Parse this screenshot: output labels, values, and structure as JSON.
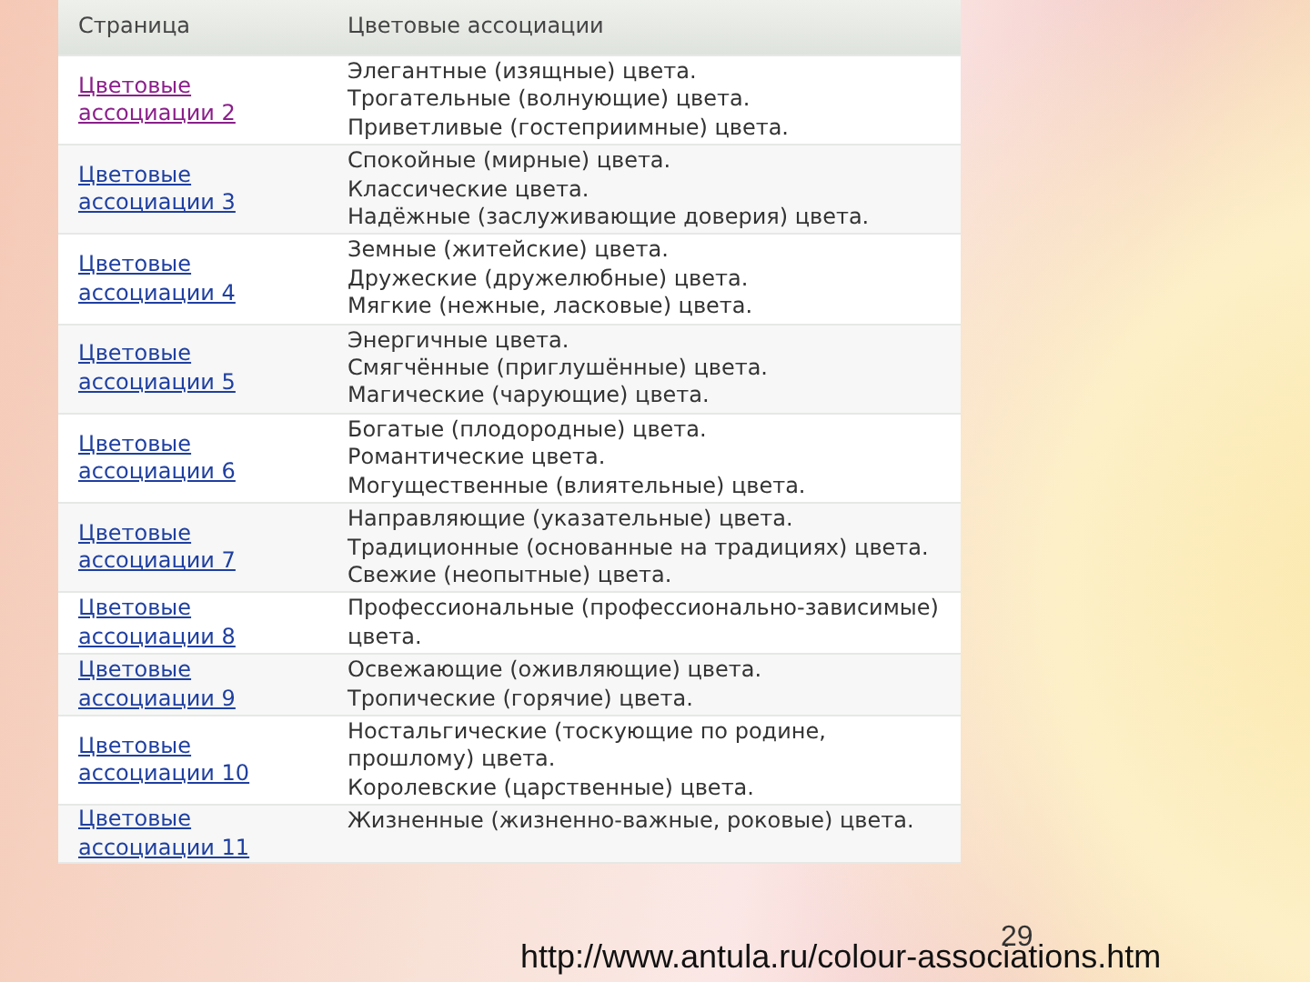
{
  "table": {
    "columns": [
      "Страница",
      "Цветовые ассоциации"
    ],
    "rows": [
      {
        "page": "Цветовые ассоциации 2",
        "visited": true,
        "associations": [
          "Элегантные (изящные) цвета.",
          "Трогательные (волнующие) цвета.",
          "Приветливые (гостеприимные) цвета."
        ]
      },
      {
        "page": "Цветовые ассоциации 3",
        "visited": false,
        "associations": [
          "Спокойные (мирные) цвета.",
          "Классические цвета.",
          "Надёжные (заслуживающие доверия) цвета."
        ]
      },
      {
        "page": "Цветовые ассоциации 4",
        "visited": false,
        "associations": [
          "Земные (житейские) цвета.",
          "Дружеские (дружелюбные) цвета.",
          "Мягкие (нежные, ласковые) цвета."
        ]
      },
      {
        "page": "Цветовые ассоциации 5",
        "visited": false,
        "associations": [
          "Энергичные цвета.",
          "Смягчённые (приглушённые) цвета.",
          "Магические (чарующие) цвета."
        ]
      },
      {
        "page": "Цветовые ассоциации 6",
        "visited": false,
        "associations": [
          "Богатые (плодородные) цвета.",
          "Романтические цвета.",
          "Могущественные (влиятельные) цвета."
        ]
      },
      {
        "page": "Цветовые ассоциации 7",
        "visited": false,
        "associations": [
          "Направляющие (указательные) цвета.",
          "Традиционные (основанные на традициях) цвета.",
          "Свежие (неопытные) цвета."
        ]
      },
      {
        "page": "Цветовые ассоциации 8",
        "visited": false,
        "associations": [
          "Профессиональные (профессионально-зависимые) цвета."
        ]
      },
      {
        "page": "Цветовые ассоциации 9",
        "visited": false,
        "associations": [
          "Освежающие (оживляющие) цвета.",
          "Тропические (горячие) цвета."
        ]
      },
      {
        "page": "Цветовые ассоциации 10",
        "visited": false,
        "associations": [
          "Ностальгические (тоскующие по родине, прошлому) цвета.",
          "Королевские (царственные) цвета."
        ]
      },
      {
        "page": "Цветовые ассоциации 11",
        "visited": false,
        "associations": [
          "Жизненные (жизненно-важные, роковые) цвета."
        ]
      }
    ]
  },
  "footer": {
    "source_url": "http://www.antula.ru/colour-associations.htm",
    "slide_number": "29"
  }
}
